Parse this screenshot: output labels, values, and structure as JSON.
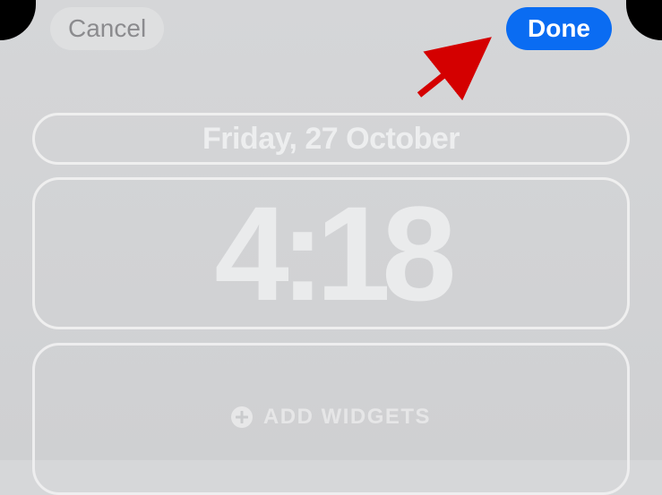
{
  "topbar": {
    "cancel_label": "Cancel",
    "done_label": "Done"
  },
  "date_panel": {
    "text": "Friday, 27 October"
  },
  "time_panel": {
    "text": "4:18"
  },
  "widgets_panel": {
    "label": "ADD WIDGETS"
  },
  "colors": {
    "done_bg": "#0a6cf2",
    "cancel_bg": "#dedfe0",
    "overlay_text": "#edeeef",
    "background": "#d6d7d9",
    "annotation": "#d40000"
  }
}
